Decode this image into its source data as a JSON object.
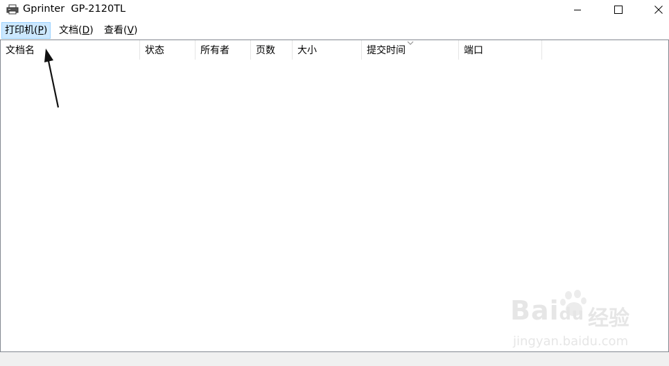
{
  "window": {
    "title": "Gprinter  GP-2120TL",
    "icon": "printer-icon",
    "controls": [
      "minimize-icon",
      "maximize-icon",
      "close-icon"
    ]
  },
  "menu": {
    "printer": {
      "label": "打印机(",
      "key": "P",
      "close": ")"
    },
    "document": {
      "label": "文档(",
      "key": "D",
      "close": ")"
    },
    "view": {
      "label": "查看(",
      "key": "V",
      "close": ")"
    }
  },
  "columns": [
    "文档名",
    "状态",
    "所有者",
    "页数",
    "大小",
    "提交时间",
    "端口"
  ],
  "sorted_column": "提交时间",
  "colors": {
    "menu_active_bg": "#cce8ff",
    "menu_active_border": "#99d1ff",
    "statusbar_bg": "#f0f0f0"
  },
  "watermark": {
    "brand_latin": "Bai",
    "brand_du": "du",
    "brand_cn": "经验",
    "url": "jingyan.baidu.com"
  }
}
